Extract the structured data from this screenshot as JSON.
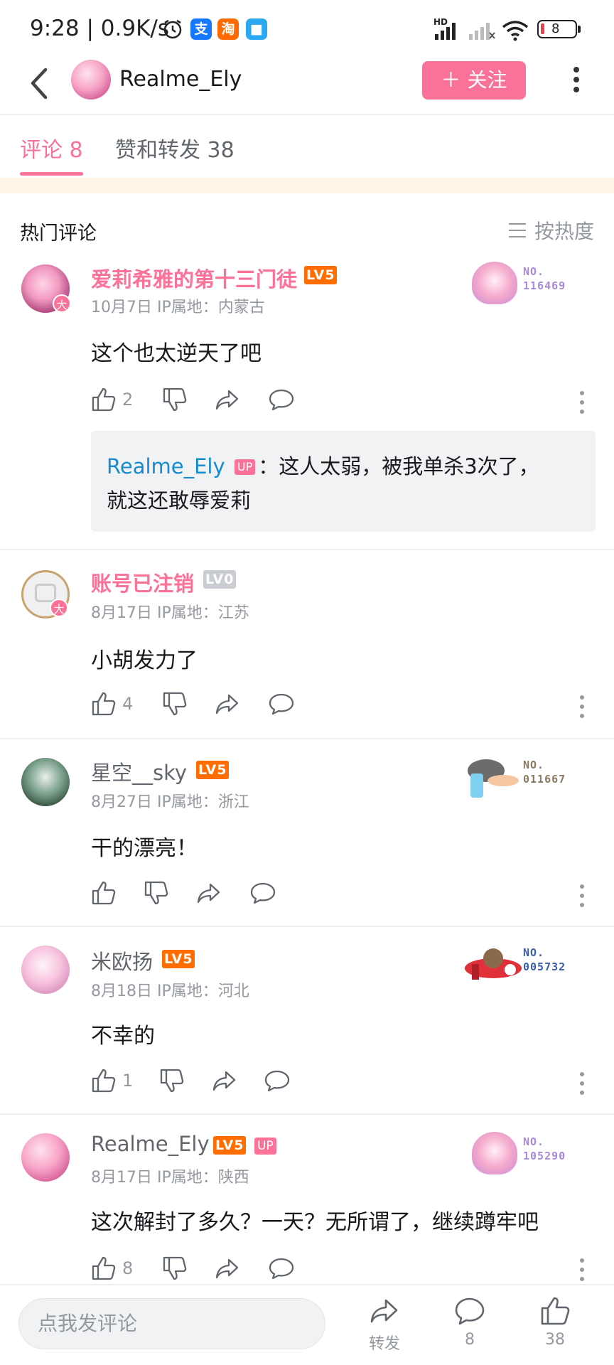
{
  "status_bar": {
    "time_speed": "9:28 | 0.9K/s",
    "signal_label": "HD",
    "battery": "8"
  },
  "header": {
    "channel_name": "Realme_Ely",
    "follow_label": "＋ 关注"
  },
  "tabs": [
    {
      "label": "评论 8",
      "active": true
    },
    {
      "label": "赞和转发 38",
      "active": false
    }
  ],
  "section": {
    "title": "热门评论",
    "sort_label": "按热度"
  },
  "comments": [
    {
      "username": "爱莉希雅的第十三门徒",
      "level": "LV5",
      "date_ip": "10月7日  IP属地：内蒙古",
      "text": "这个也太逆天了吧",
      "likes": "2",
      "fan_badge_no": "NO.\n116469",
      "reply": {
        "author": "Realme_Ely",
        "tag": "UP",
        "line1": "：这人太弱，被我单杀3次了，",
        "line2": "就这还敢辱爱莉"
      }
    },
    {
      "username": "账号已注销",
      "level": "LV0",
      "date_ip": "8月17日  IP属地：江苏",
      "text": "小胡发力了",
      "likes": "4"
    },
    {
      "username": "星空__sky",
      "level": "LV5",
      "date_ip": "8月27日  IP属地：浙江",
      "text": "干的漂亮！",
      "likes": "",
      "fan_badge_no": "NO.\n011667"
    },
    {
      "username": "米欧扬",
      "level": "LV5",
      "date_ip": "8月18日  IP属地：河北",
      "text": "不幸的",
      "likes": "1",
      "fan_badge_no": "NO.\n005732"
    },
    {
      "username": "Realme_Ely",
      "level": "LV5",
      "tag": "UP",
      "date_ip": "8月17日  IP属地：陕西",
      "text": "这次解封了多久？一天？无所谓了，继续蹲牢吧",
      "likes": "8",
      "fan_badge_no": "NO.\n105290"
    }
  ],
  "bottom_bar": {
    "input_placeholder": "点我发评论",
    "share_label": "转发",
    "comment_count": "8",
    "like_count": "38"
  },
  "colors": {
    "accent_pink": "#fb7299",
    "link_blue": "#178bcf",
    "level_orange": "#ff6c00",
    "text_gray": "#9499a0"
  }
}
